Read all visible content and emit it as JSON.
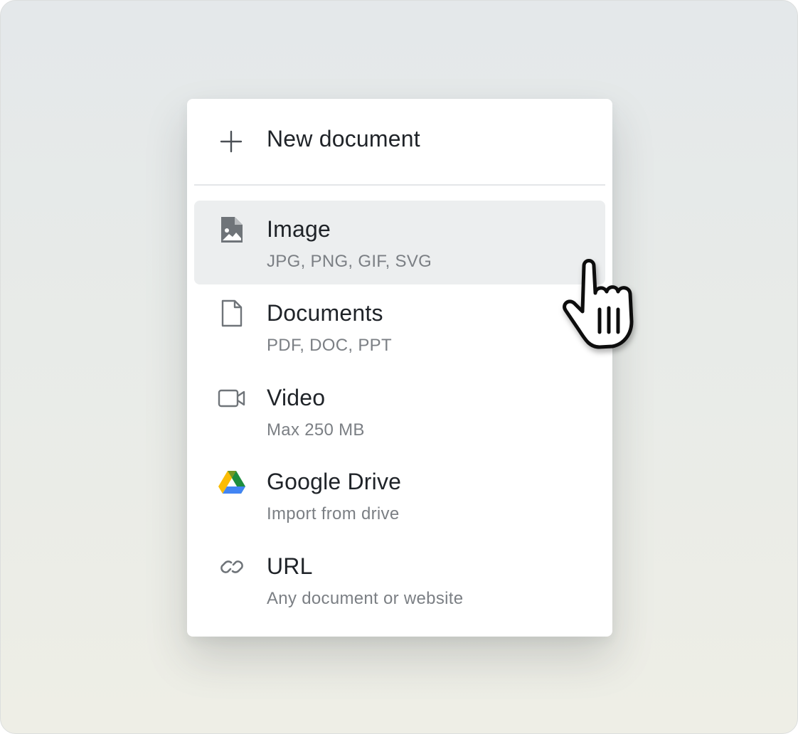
{
  "menu": {
    "new_document": {
      "label": "New document",
      "icon": "plus-icon"
    },
    "items": [
      {
        "id": "image",
        "title": "Image",
        "subtitle": "JPG, PNG, GIF, SVG",
        "icon": "image-file-icon",
        "hovered": true
      },
      {
        "id": "documents",
        "title": "Documents",
        "subtitle": "PDF, DOC, PPT",
        "icon": "document-icon",
        "hovered": false
      },
      {
        "id": "video",
        "title": "Video",
        "subtitle": "Max 250 MB",
        "icon": "video-camera-icon",
        "hovered": false
      },
      {
        "id": "google-drive",
        "title": "Google Drive",
        "subtitle": "Import from drive",
        "icon": "google-drive-icon",
        "hovered": false
      },
      {
        "id": "url",
        "title": "URL",
        "subtitle": "Any document or website",
        "icon": "link-icon",
        "hovered": false
      }
    ]
  },
  "cursor": {
    "icon": "hand-pointer-cursor-icon"
  },
  "colors": {
    "text_primary": "#1f2328",
    "text_secondary": "#7b7f84",
    "icon_gray": "#6f7479",
    "hover_background": "#eceeef",
    "drive_green": "#1e8e3e",
    "drive_yellow": "#fbbc04",
    "drive_blue": "#4285f4"
  }
}
